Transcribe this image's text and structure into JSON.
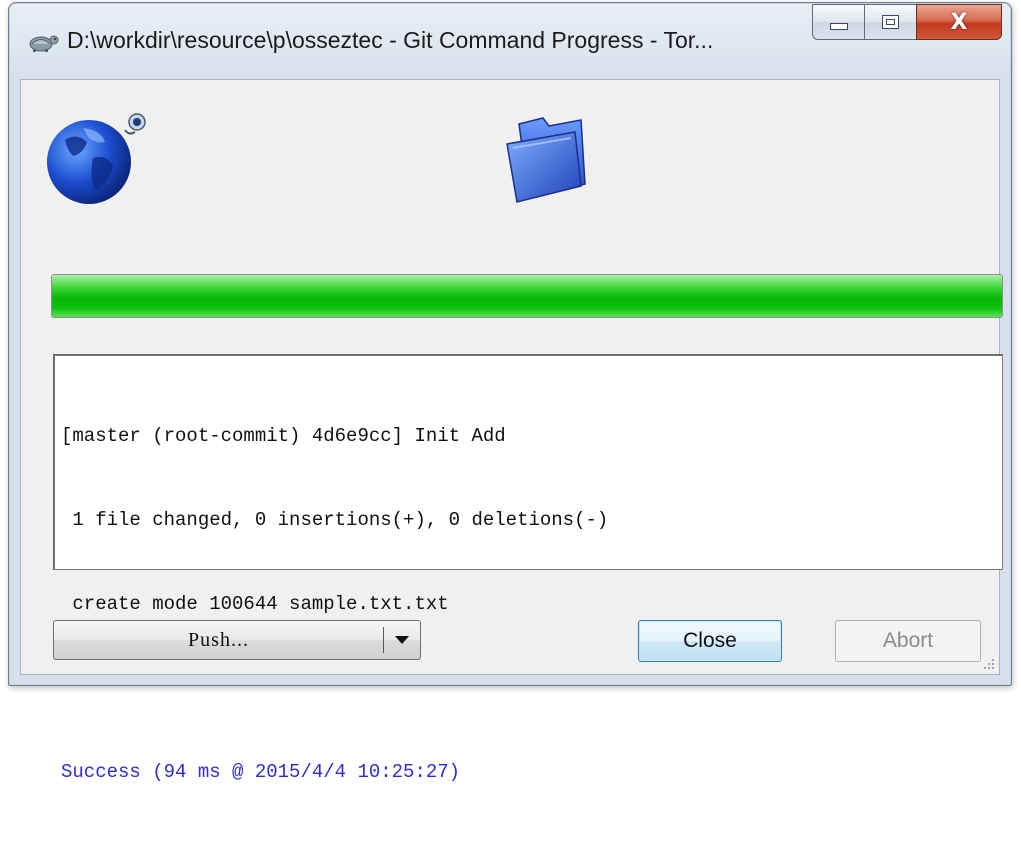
{
  "window": {
    "title": "D:\\workdir\\resource\\p\\osseztec - Git Command Progress - Tor..."
  },
  "icons": {
    "title": "tortoisegit-icon",
    "remote": "globe-icon",
    "local": "folder-icon"
  },
  "progress": {
    "fraction": 1.0,
    "color": "#0fc40f"
  },
  "log": {
    "lines": [
      "[master (root-commit) 4d6e9cc] Init Add",
      " 1 file changed, 0 insertions(+), 0 deletions(-)",
      " create mode 100644 sample.txt.txt",
      "",
      "Success (94 ms @ 2015/4/4 10:25:27)"
    ],
    "success_color": "#2d2dd6"
  },
  "buttons": {
    "push_label": "Push...",
    "close_label": "Close",
    "abort_label": "Abort"
  }
}
